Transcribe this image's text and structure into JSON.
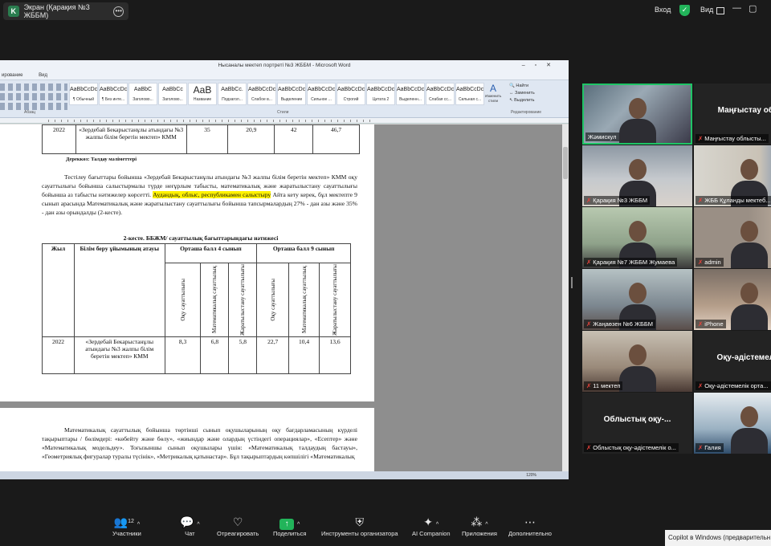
{
  "topbar": {
    "share_title": "Экран (Қарақия №3 ЖББМ)",
    "share_icon_letter": "K",
    "enter_label": "Вход",
    "view_label": "Вид"
  },
  "word": {
    "title": "Нысаналы мектеп портреті №3 ЖББМ - Microsoft Word",
    "tabs": [
      "ированиe",
      "Вид"
    ],
    "styles": [
      {
        "sample": "AaBbCcDc",
        "name": "¶ Обычный"
      },
      {
        "sample": "AaBbCcDc",
        "name": "¶ Без инте..."
      },
      {
        "sample": "AaBbC",
        "name": "Заголово..."
      },
      {
        "sample": "AaBbCc",
        "name": "Заголово..."
      },
      {
        "sample": "AaB",
        "name": "Название"
      },
      {
        "sample": "AaBbCc.",
        "name": "Подзагол..."
      },
      {
        "sample": "AaBbCcDc",
        "name": "Слабое в..."
      },
      {
        "sample": "AaBbCcDc",
        "name": "Выделение"
      },
      {
        "sample": "AaBbCcDc",
        "name": "Сильное ..."
      },
      {
        "sample": "AaBbCcDc",
        "name": "Строгий"
      },
      {
        "sample": "AaBbCcDc",
        "name": "Цитата 2"
      },
      {
        "sample": "AaBbCcDc",
        "name": "Выделенн..."
      },
      {
        "sample": "AaBbCcDc",
        "name": "Слабая сс..."
      },
      {
        "sample": "AaBbCcDc",
        "name": "Сильная с..."
      }
    ],
    "change_styles": "Изменить стили",
    "find": "Найти",
    "replace": "Заменить",
    "select": "Выделить",
    "groups": {
      "paragraph": "Абзац",
      "styles": "Стили",
      "editing": "Редактирование"
    },
    "status_zoom": "120%",
    "table1": {
      "year": "2022",
      "school": "«Зердебай Бекарыстанұлы атындағы №3 жалпы білім беретін мектеп» КММ",
      "values": [
        "35",
        "20,9",
        "42",
        "46,7"
      ]
    },
    "source": "Дереккөз: Талдау мәліметтері",
    "para1_a": "Тестілеу бағыттары бойынша «Зердебай Бекарыстанұлы атындағы №3 жалпы білім беретін мектеп» КММ оқу сауаттылығы бойынша салыстырмалы түрде неғұрлым табысты, математикалық және жаратылыстану сауаттылығы бойынша аз табысты нәтижелер көрсетті.",
    "para1_hl": "Аудандық, облыс, республикамен салыстыру",
    "para1_b": "Айта кету керек, бұл мектепте 9 сынып арасында Математикалық және жаратылыстану сауаттылығы бойынша тапсырмалардың 27% - дан азы және 35% - дан азы орындалды (2-кесте).",
    "table2_caption": "2-кесте. ББЖМ/ сауаттылық бағыттарындағы нәтижесі",
    "table2": {
      "h_year": "Жыл",
      "h_org": "Білім беру ұйымының атауы",
      "h_g4": "Орташа балл 4 сынып",
      "h_g9": "Орташа балл 9 сынып",
      "sub": [
        "Оқу сауаттылығы",
        "Математикалық сауаттылық",
        "Жаратылыстану сауаттылығы",
        "Оқу сауаттылығы",
        "Математикалық сауаттылық",
        "Жаратылыстану сауаттылығы"
      ],
      "year": "2022",
      "school": "«Зердебай Бекарыстанұлы атындағы №3 жалпы білім беретін мектеп» КММ",
      "values": [
        "8,3",
        "6,8",
        "5,8",
        "22,7",
        "10,4",
        "13,6"
      ]
    },
    "para2": "Математикалық сауаттылық бойынша төртінші сынып оқушыларының оқу бағдарламасының күрделі тақырыптары / бөлімдері: «көбейту және бөлу», «жиындар және олардың үстіндегі операциялар», «Есептер» және «Математикалық модельдеу». Тоғызыншы сынып оқушылары үшін: «Математикалық талдаудың бастауы», «Геометриялық фигуралар туралы түсінік», «Метрикалық қатынастар». Бұл тақырыптардың көпшілігі «Математикалық"
  },
  "participants": [
    {
      "name": "Жәмискул",
      "mic": false
    },
    {
      "big": "Маңғыстау об...",
      "name": "Маңғыстау облысты...",
      "mic": true
    },
    {
      "name": "Қарақия №3 ЖББМ",
      "mic": true
    },
    {
      "name": "ЖББ Құланды мектеб...",
      "mic": true
    },
    {
      "name": "Қарақия №7 ЖББМ Жумаева",
      "mic": true
    },
    {
      "name": "admin",
      "mic": true
    },
    {
      "name": "Жаңаөзен №6 ЖББМ",
      "mic": true
    },
    {
      "name": "iPhone",
      "mic": true
    },
    {
      "name": "11 мектеп",
      "mic": true
    },
    {
      "big": "Оқу-әдістемел...",
      "name": "Оқу-әдістемелік орта...",
      "mic": true
    },
    {
      "big": "Облыстық оқу-...",
      "name": "Облыстық оқу-әдістемелік о...",
      "mic": true
    },
    {
      "name": "Галия",
      "mic": true
    }
  ],
  "bottom": {
    "participants_label": "Участники",
    "participants_count": "12",
    "chat": "Чат",
    "react": "Отреагировать",
    "share": "Поделиться",
    "host_tools": "Инструменты организатора",
    "ai": "AI Companion",
    "apps": "Приложения",
    "more": "Дополнительно"
  },
  "copilot": "Copilot в Windows (предварительн",
  "colors": {
    "active_border": "#1fc466",
    "share_green": "#22b45a",
    "mic_red": "#e8423b",
    "highlight": "#fff200"
  }
}
